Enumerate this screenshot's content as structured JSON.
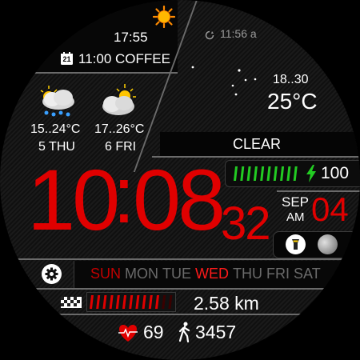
{
  "top": {
    "sun_icon": "sun-icon",
    "sunrise_time": "17:55",
    "event_day": "21",
    "event": "11:00 COFFEE",
    "alarm_time": "11:56 a"
  },
  "forecast": [
    {
      "temp_range": "15..24°C",
      "day": "5 THU",
      "icon": "rain-cloud-icon"
    },
    {
      "temp_range": "17..26°C",
      "day": "6 FRI",
      "icon": "sun-cloud-icon"
    }
  ],
  "current_weather": {
    "icon": "moon-stars-icon",
    "range": "18..30",
    "temp": "25°C",
    "condition": "CLEAR"
  },
  "battery": {
    "level": "100",
    "fraction": 1.0
  },
  "time": {
    "hours": "10",
    "colon": ":",
    "minutes": "08",
    "seconds": "32",
    "month": "SEP",
    "ampm": "AM",
    "day": "04"
  },
  "weekdays": [
    {
      "label": "SUN",
      "state": "weekend"
    },
    {
      "label": "MON",
      "state": "normal"
    },
    {
      "label": "TUE",
      "state": "normal"
    },
    {
      "label": "WED",
      "state": "current"
    },
    {
      "label": "THU",
      "state": "normal"
    },
    {
      "label": "FRI",
      "state": "normal"
    },
    {
      "label": "SAT",
      "state": "normal"
    }
  ],
  "distance": {
    "value": "2.58 km",
    "fraction": 0.85
  },
  "health": {
    "heart_rate": "69",
    "steps": "3457"
  },
  "colors": {
    "accent": "#e00000",
    "battery": "#22cc22",
    "text": "#ffffff",
    "dim": "#9a9a9a"
  }
}
